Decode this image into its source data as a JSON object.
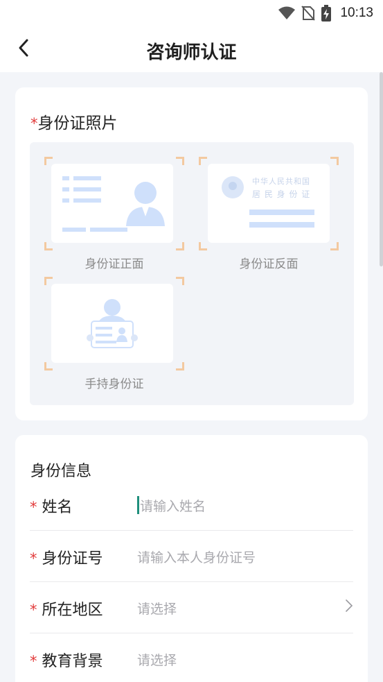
{
  "status_bar": {
    "time": "10:13",
    "icons": [
      "wifi-icon",
      "no-sim-icon",
      "battery-charging-icon"
    ]
  },
  "nav": {
    "title": "咨询师认证",
    "back_icon": "chevron-left-icon"
  },
  "photos_section": {
    "required_mark": "*",
    "title": "身份证照片",
    "slots": [
      {
        "label": "身份证正面",
        "icon": "id-card-front-icon"
      },
      {
        "label": "身份证反面",
        "icon": "id-card-back-icon",
        "emblem_text_1": "中华人民共和国",
        "emblem_text_2": "居 民 身 份 证"
      },
      {
        "label": "手持身份证",
        "icon": "hand-holding-id-icon"
      }
    ]
  },
  "info_section": {
    "title": "身份信息",
    "fields": [
      {
        "required_mark": "*",
        "label": "姓名",
        "placeholder": "请输入姓名",
        "focused": true
      },
      {
        "required_mark": "*",
        "label": "身份证号",
        "placeholder": "请输入本人身份证号"
      },
      {
        "required_mark": "*",
        "label": "所在地区",
        "placeholder": "请选择",
        "has_chevron": true
      },
      {
        "required_mark": "*",
        "label": "教育背景",
        "placeholder": "请选择"
      }
    ]
  },
  "colors": {
    "required": "#e23b3b",
    "corner_bracket": "#f3c9a0",
    "illustration_blue": "#cfe0fb",
    "caret": "#1f8f7c",
    "background": "#f3f5f9"
  }
}
